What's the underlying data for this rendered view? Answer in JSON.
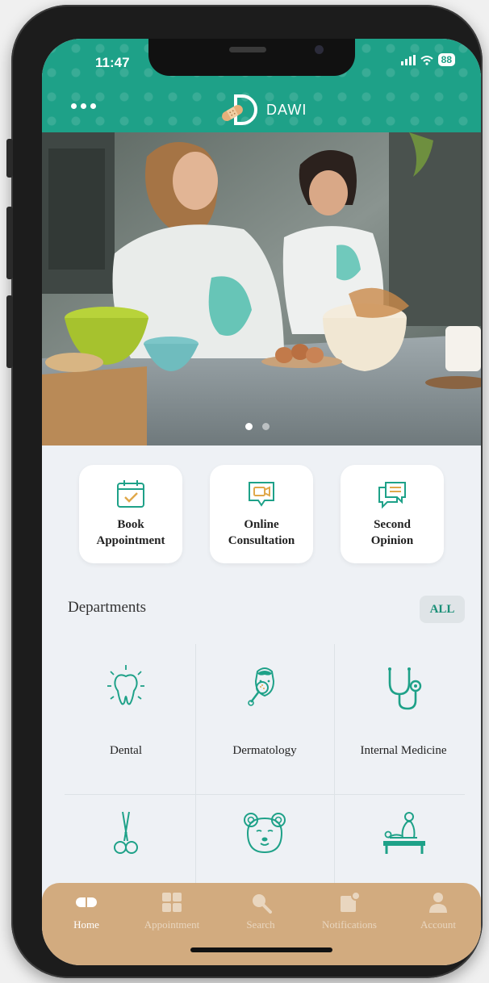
{
  "status_bar": {
    "time": "11:47",
    "battery": "88"
  },
  "header": {
    "brand": "DAWI"
  },
  "carousel": {
    "count": 2,
    "active_index": 0
  },
  "quick_actions": [
    {
      "line1": "Book",
      "line2": "Appointment",
      "icon": "calendar-check-icon"
    },
    {
      "line1": "Online",
      "line2": "Consultation",
      "icon": "video-chat-icon"
    },
    {
      "line1": "Second",
      "line2": "Opinion",
      "icon": "chat-bubbles-icon"
    }
  ],
  "departments": {
    "title": "Departments",
    "all_label": "ALL",
    "items": [
      {
        "label": "Dental",
        "icon": "tooth-icon"
      },
      {
        "label": "Dermatology",
        "icon": "dermatology-face-icon"
      },
      {
        "label": "Internal Medicine",
        "icon": "stethoscope-icon"
      },
      {
        "label": "",
        "icon": "surgical-scissors-icon"
      },
      {
        "label": "",
        "icon": "teddy-bear-icon"
      },
      {
        "label": "",
        "icon": "physiotherapy-icon"
      }
    ]
  },
  "tabbar": {
    "active": "Home",
    "tabs": [
      {
        "label": "Home",
        "icon": "home-pill-icon"
      },
      {
        "label": "Appointment",
        "icon": "grid-icon"
      },
      {
        "label": "Search",
        "icon": "search-icon"
      },
      {
        "label": "Notifications",
        "icon": "notification-icon"
      },
      {
        "label": "Account",
        "icon": "account-icon"
      }
    ]
  },
  "colors": {
    "primary": "#1ea188",
    "tabbar": "#d2ab7f",
    "background": "#eef1f5"
  }
}
